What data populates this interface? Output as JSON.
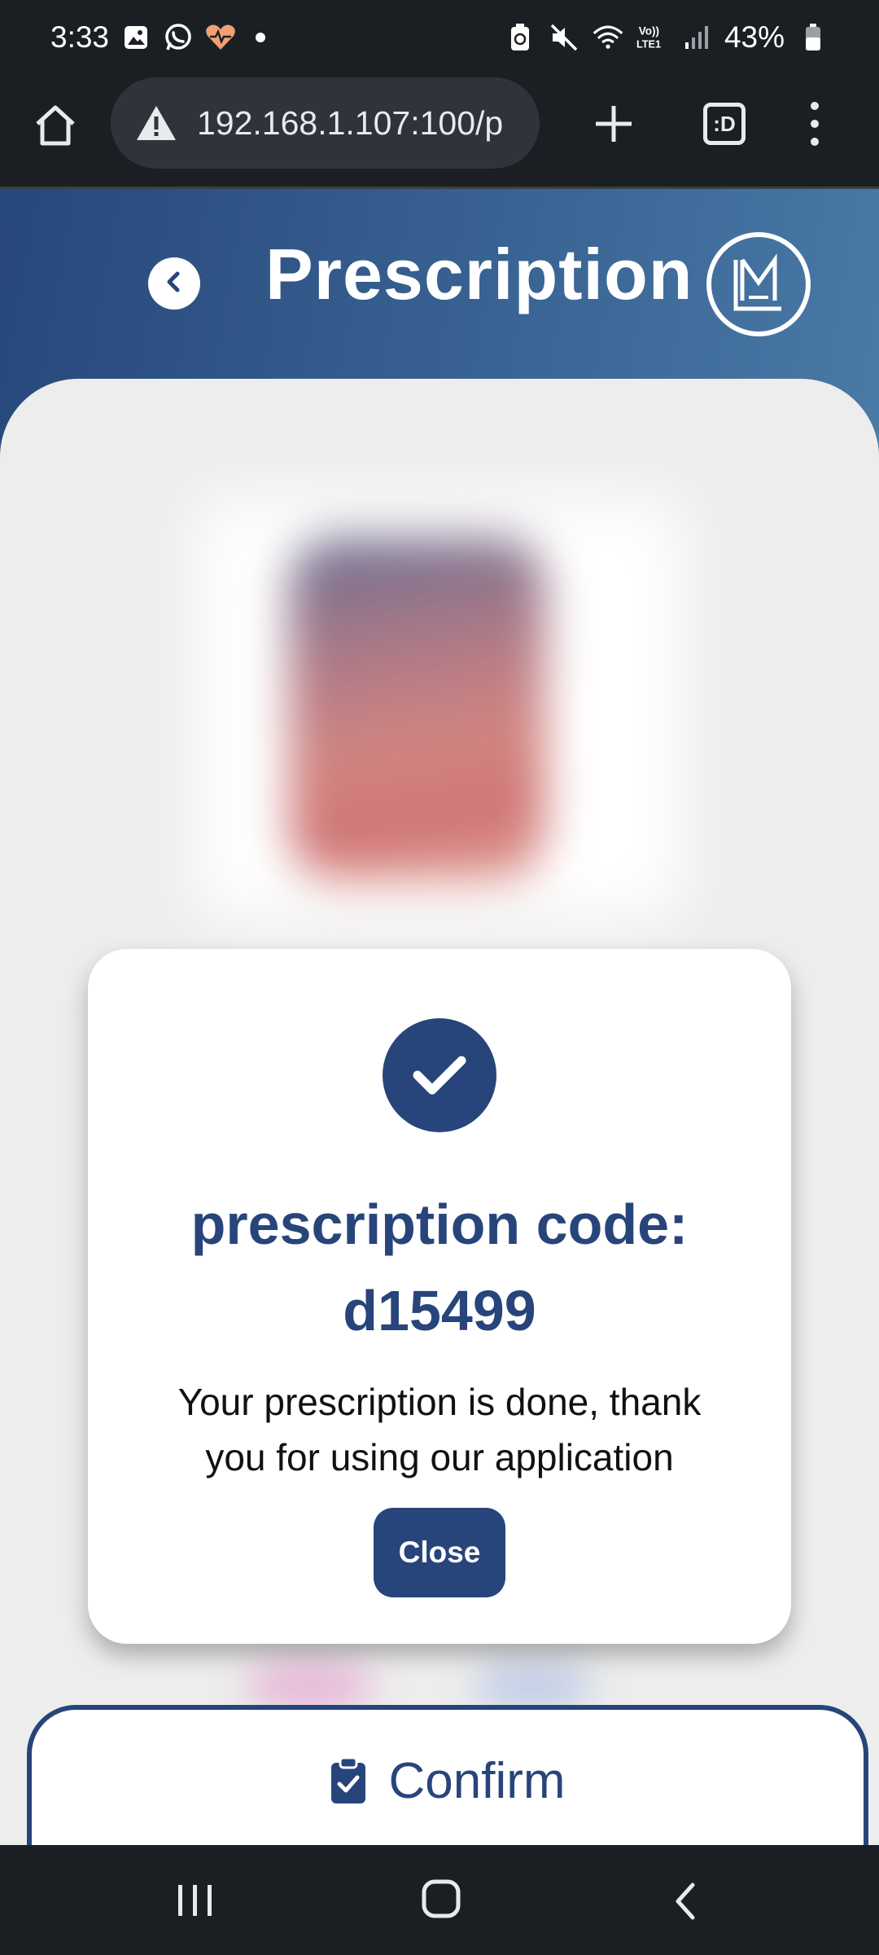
{
  "status_bar": {
    "time": "3:33",
    "battery": "43%",
    "left_icons": [
      "gallery-icon",
      "whatsapp-icon",
      "health-icon",
      "notification-dot"
    ],
    "right_icons": [
      "battery-saver-icon",
      "mute-icon",
      "wifi-icon",
      "volte-lte1-icon",
      "signal-icon",
      "battery-icon"
    ]
  },
  "browser": {
    "url": "192.168.1.107:100/p",
    "tabs_label": ":D"
  },
  "header": {
    "title": "Prescription",
    "back_icon": "chevron-left-icon",
    "logo_icon": "lm-logo-icon"
  },
  "modal": {
    "title_line1": "prescription code:",
    "title_line2": "d15499",
    "message": "Your prescription is done, thank you for using our application",
    "close_label": "Close",
    "icon": "check-icon"
  },
  "confirm": {
    "label": "Confirm",
    "icon": "clipboard-check-icon"
  },
  "colors": {
    "primary": "#27457a",
    "header_gradient_start": "#27477a",
    "header_gradient_end": "#4a7aa6",
    "system_bar": "#1b1f24",
    "background": "#ededed"
  }
}
